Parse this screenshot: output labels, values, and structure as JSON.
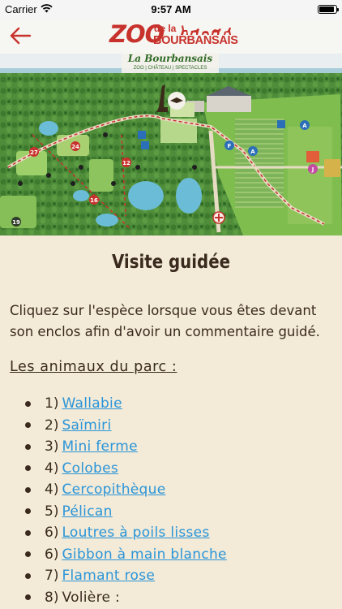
{
  "status": {
    "carrier": "Carrier",
    "time": "9:57 AM",
    "battery_level": 0.9
  },
  "nav": {
    "logo_zoo": "ZOO",
    "logo_de": "de la",
    "logo_bour": "BOURBANSAIS",
    "back_icon": "arrow-left-icon"
  },
  "map": {
    "title": "La Bourbansais",
    "subtitle": "ZOO | CHÂTEAU | SPECTACLES",
    "markers": [
      "27",
      "24",
      "16",
      "12",
      "19"
    ],
    "letter_markers": [
      "F",
      "A",
      "A",
      "J"
    ]
  },
  "page": {
    "title": "Visite guidée",
    "intro": "Cliquez sur l'espèce lorsque vous êtes devant son enclos afin d'avoir un commentaire guidé.",
    "section_heading": "Les animaux du parc :"
  },
  "animals": [
    {
      "num": "1)",
      "name": "Wallabie",
      "link": true
    },
    {
      "num": "2)",
      "name": "Saïmiri",
      "link": true
    },
    {
      "num": "3)",
      "name": "Mini ferme",
      "link": true
    },
    {
      "num": "4)",
      "name": "Colobes",
      "link": true
    },
    {
      "num": "4)",
      "name": "Cercopithèque",
      "link": true
    },
    {
      "num": "5)",
      "name": "Pélican",
      "link": true
    },
    {
      "num": "6)",
      "name": "Loutres à poils lisses",
      "link": true
    },
    {
      "num": "6)",
      "name": "Gibbon à main blanche",
      "link": true
    },
    {
      "num": "7)",
      "name": "Flamant rose",
      "link": true
    },
    {
      "num": "8)",
      "name": "Volière :",
      "link": false
    }
  ],
  "colors": {
    "background": "#f3ead7",
    "link": "#2a95d9",
    "brand_red": "#c8322c",
    "text": "#3a2a1e"
  }
}
